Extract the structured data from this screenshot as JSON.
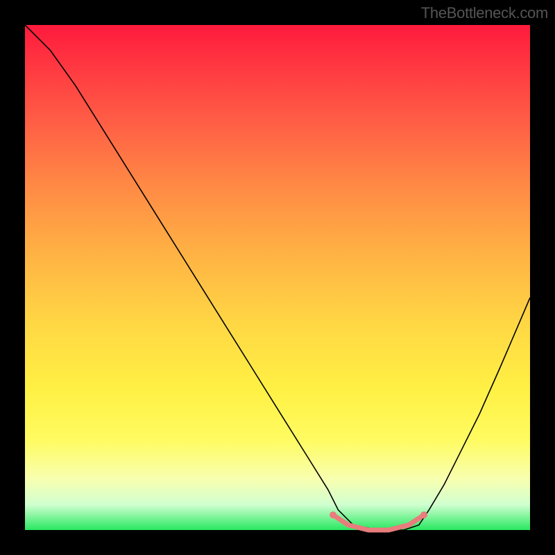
{
  "watermark": "TheBottleneck.com",
  "chart_data": {
    "type": "line",
    "title": "",
    "xlabel": "",
    "ylabel": "",
    "xlim": [
      0,
      100
    ],
    "ylim": [
      0,
      100
    ],
    "grid": false,
    "legend": false,
    "background_gradient": {
      "top": "#ff1a3c",
      "mid": "#ffd944",
      "bottom": "#28e860"
    },
    "series": [
      {
        "name": "curve",
        "color": "#000000",
        "x": [
          0,
          5,
          10,
          15,
          20,
          25,
          30,
          35,
          40,
          45,
          50,
          55,
          60,
          62,
          65,
          70,
          75,
          78,
          80,
          83,
          86,
          90,
          94,
          97,
          100
        ],
        "y": [
          100,
          95,
          88,
          80,
          72,
          64,
          56,
          48,
          40,
          32,
          24,
          16,
          8,
          4,
          1,
          0,
          0,
          1,
          4,
          9,
          15,
          23,
          32,
          39,
          46
        ]
      },
      {
        "name": "highlight",
        "color": "#e97c7c",
        "x": [
          61,
          64,
          68,
          72,
          76,
          79
        ],
        "y": [
          3,
          1,
          0,
          0,
          1,
          3
        ]
      }
    ]
  }
}
